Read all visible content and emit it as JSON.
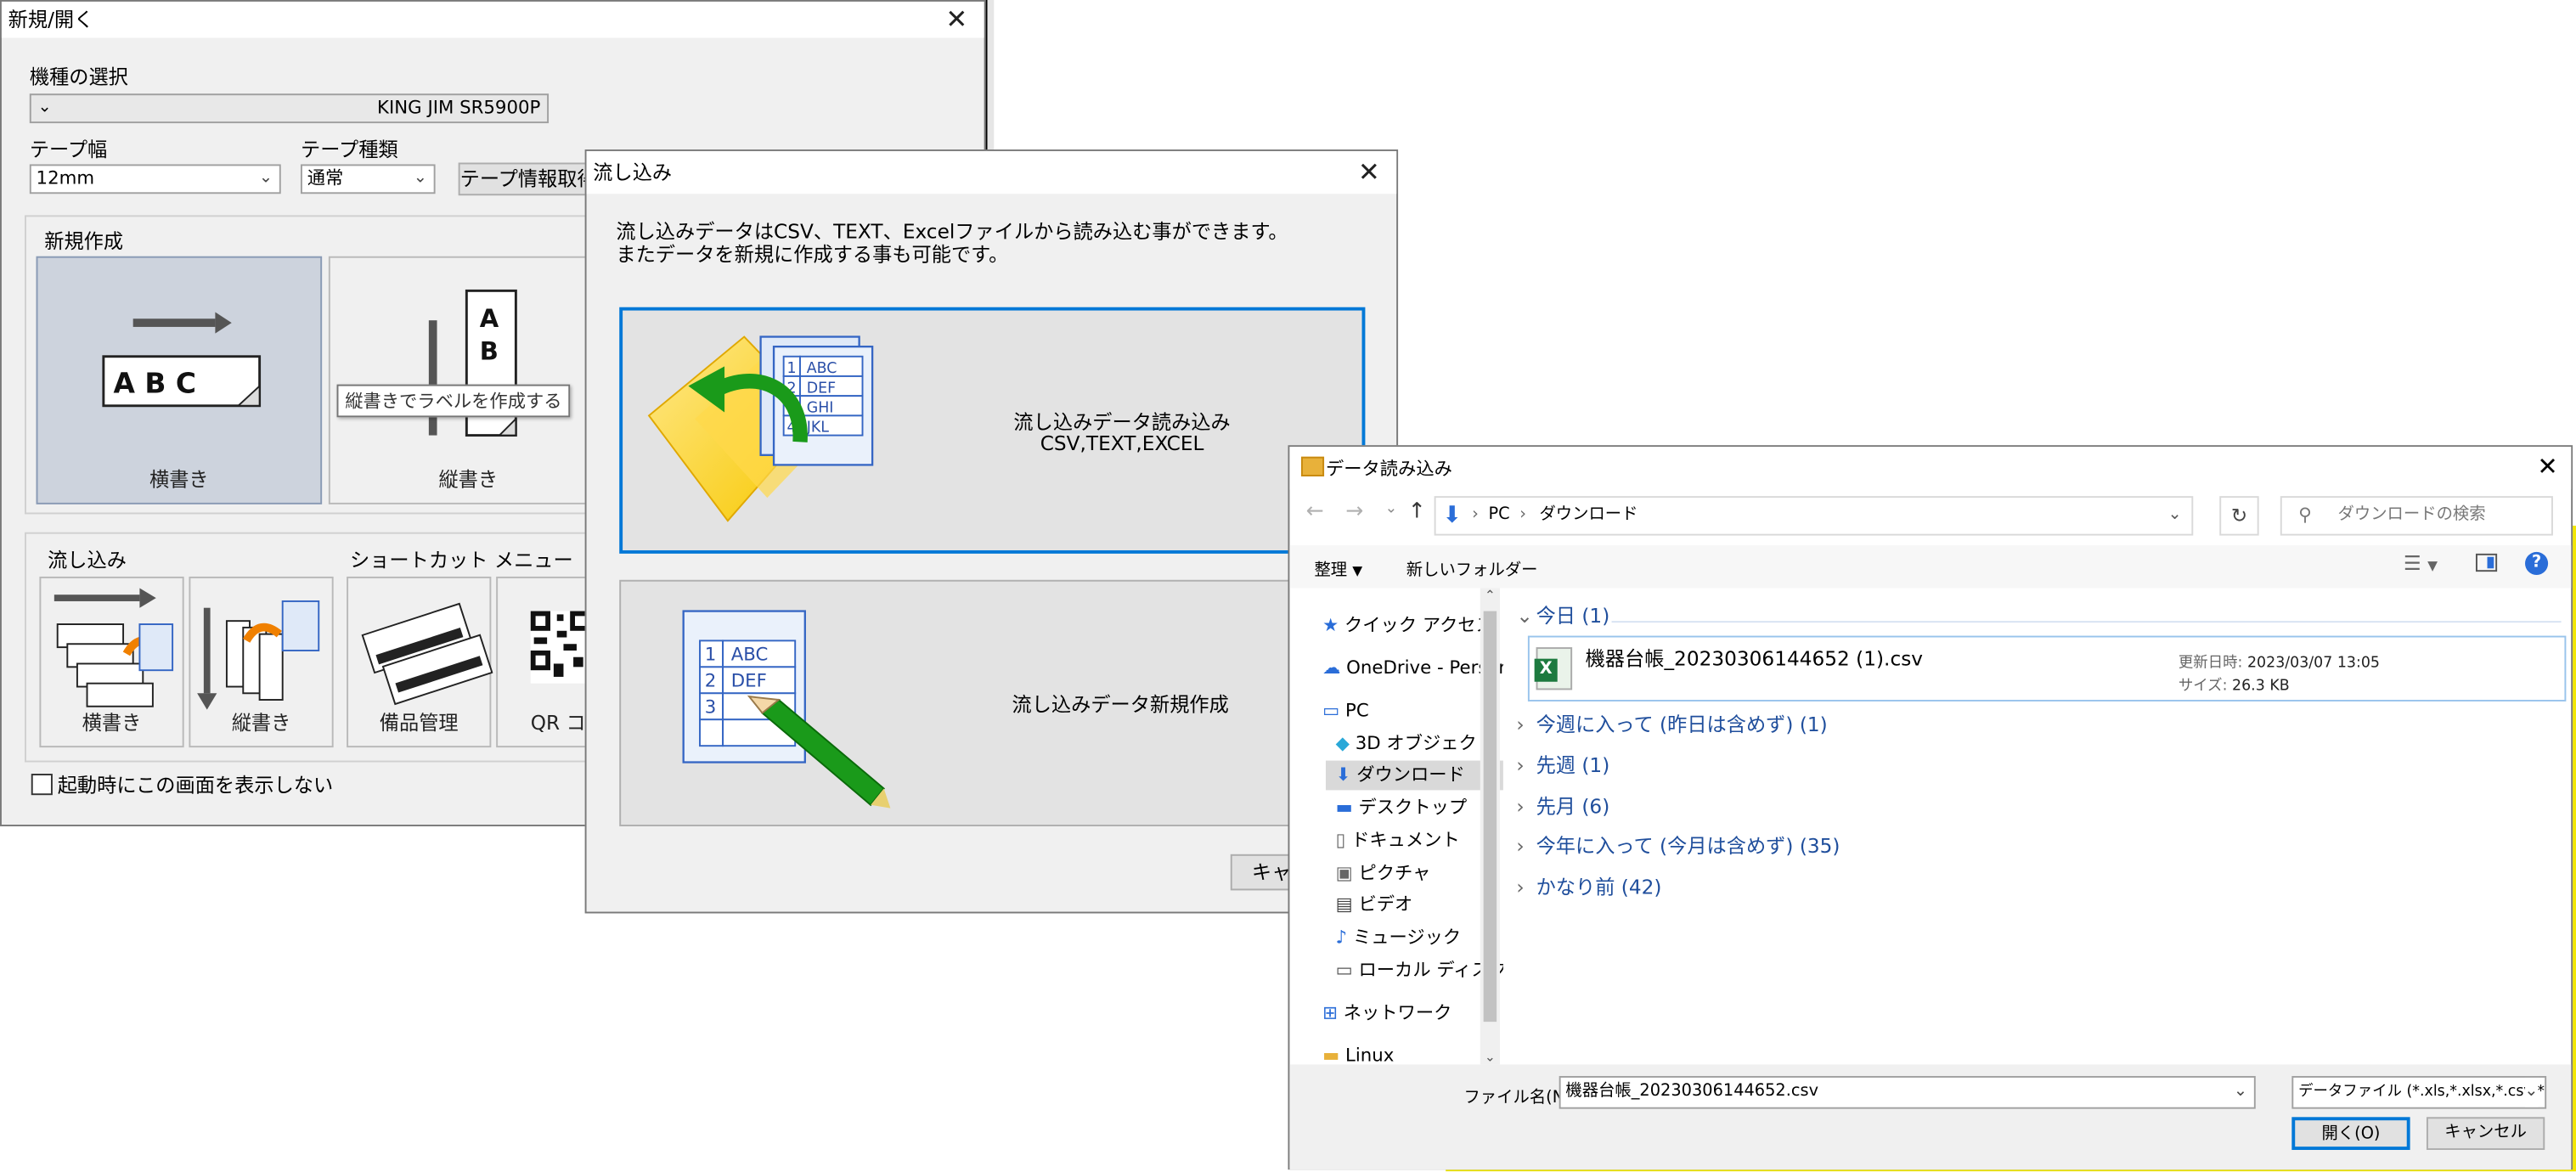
{
  "win1": {
    "title": "新規/開く",
    "model_label": "機種の選択",
    "model_value": "KING JIM SR5900P",
    "tape_width_label": "テープ幅",
    "tape_width_value": "12mm",
    "tape_type_label": "テープ種類",
    "tape_type_value": "通常",
    "tape_info_button": "テープ情報取得",
    "new_section": "新規作成",
    "tile_horizontal": "横書き",
    "tile_vertical": "縦書き",
    "tooltip": "縦書きでラベルを作成する",
    "flow_section": "流し込み",
    "shortcut_section": "ショートカット メニュー",
    "flow_horizontal": "横書き",
    "flow_vertical": "縦書き",
    "equipment": "備品管理",
    "qr": "QR コー",
    "startup_checkbox": "起動時にこの画面を表示しない",
    "abc": "A B C"
  },
  "win2": {
    "title": "流し込み",
    "desc_line1": "流し込みデータはCSV、TEXT、Excelファイルから読み込む事ができます。",
    "desc_line2": "またデータを新規に作成する事も可能です。",
    "option1_line1": "流し込みデータ読み込み",
    "option1_line2": "CSV,TEXT,EXCEL",
    "option2": "流し込みデータ新規作成",
    "cancel_button": "キャ",
    "table_rows": [
      {
        "n": "1",
        "t": "ABC"
      },
      {
        "n": "2",
        "t": "DEF"
      },
      {
        "n": "3",
        "t": "GHI"
      },
      {
        "n": "4",
        "t": "JKL"
      }
    ]
  },
  "win3": {
    "title": "データ読み込み",
    "breadcrumb_pc": "PC",
    "breadcrumb_folder": "ダウンロード",
    "search_placeholder": "ダウンロードの検索",
    "organize": "整理",
    "new_folder": "新しいフォルダー",
    "nav": [
      {
        "label": "クイック アクセス",
        "icon": "star-icon"
      },
      {
        "label": "OneDrive - Persor",
        "icon": "cloud-icon"
      },
      {
        "label": "PC",
        "icon": "pc-icon"
      },
      {
        "label": "3D オブジェクト",
        "icon": "cube-icon"
      },
      {
        "label": "ダウンロード",
        "icon": "download-icon"
      },
      {
        "label": "デスクトップ",
        "icon": "desktop-icon"
      },
      {
        "label": "ドキュメント",
        "icon": "document-icon"
      },
      {
        "label": "ピクチャ",
        "icon": "picture-icon"
      },
      {
        "label": "ビデオ",
        "icon": "video-icon"
      },
      {
        "label": "ミュージック",
        "icon": "music-icon"
      },
      {
        "label": "ローカル ディスク (C",
        "icon": "disk-icon"
      },
      {
        "label": "ネットワーク",
        "icon": "network-icon"
      },
      {
        "label": "Linux",
        "icon": "folder-icon"
      }
    ],
    "groups": [
      "今日 (1)",
      "今週に入って (昨日は含めず) (1)",
      "先週 (1)",
      "先月 (6)",
      "今年に入って (今月は含めず) (35)",
      "かなり前 (42)"
    ],
    "file": {
      "name": "機器台帳_20230306144652 (1).csv",
      "modified_label": "更新日時:",
      "modified": "2023/03/07 13:05",
      "size_label": "サイズ:",
      "size": "26.3 KB"
    },
    "filename_label": "ファイル名(N):",
    "filename_value": "機器台帳_20230306144652.csv",
    "filter_value": "データファイル (*.xls,*.xlsx,*.csv,*.txt,",
    "open_button": "開く(O)",
    "cancel_button": "キャンセル"
  },
  "colors": {
    "accent_blue": "#0078d7",
    "group_text": "#1f4e9c",
    "background_yellow": "#f2e600",
    "tile_selected": "#cdd3dd"
  }
}
